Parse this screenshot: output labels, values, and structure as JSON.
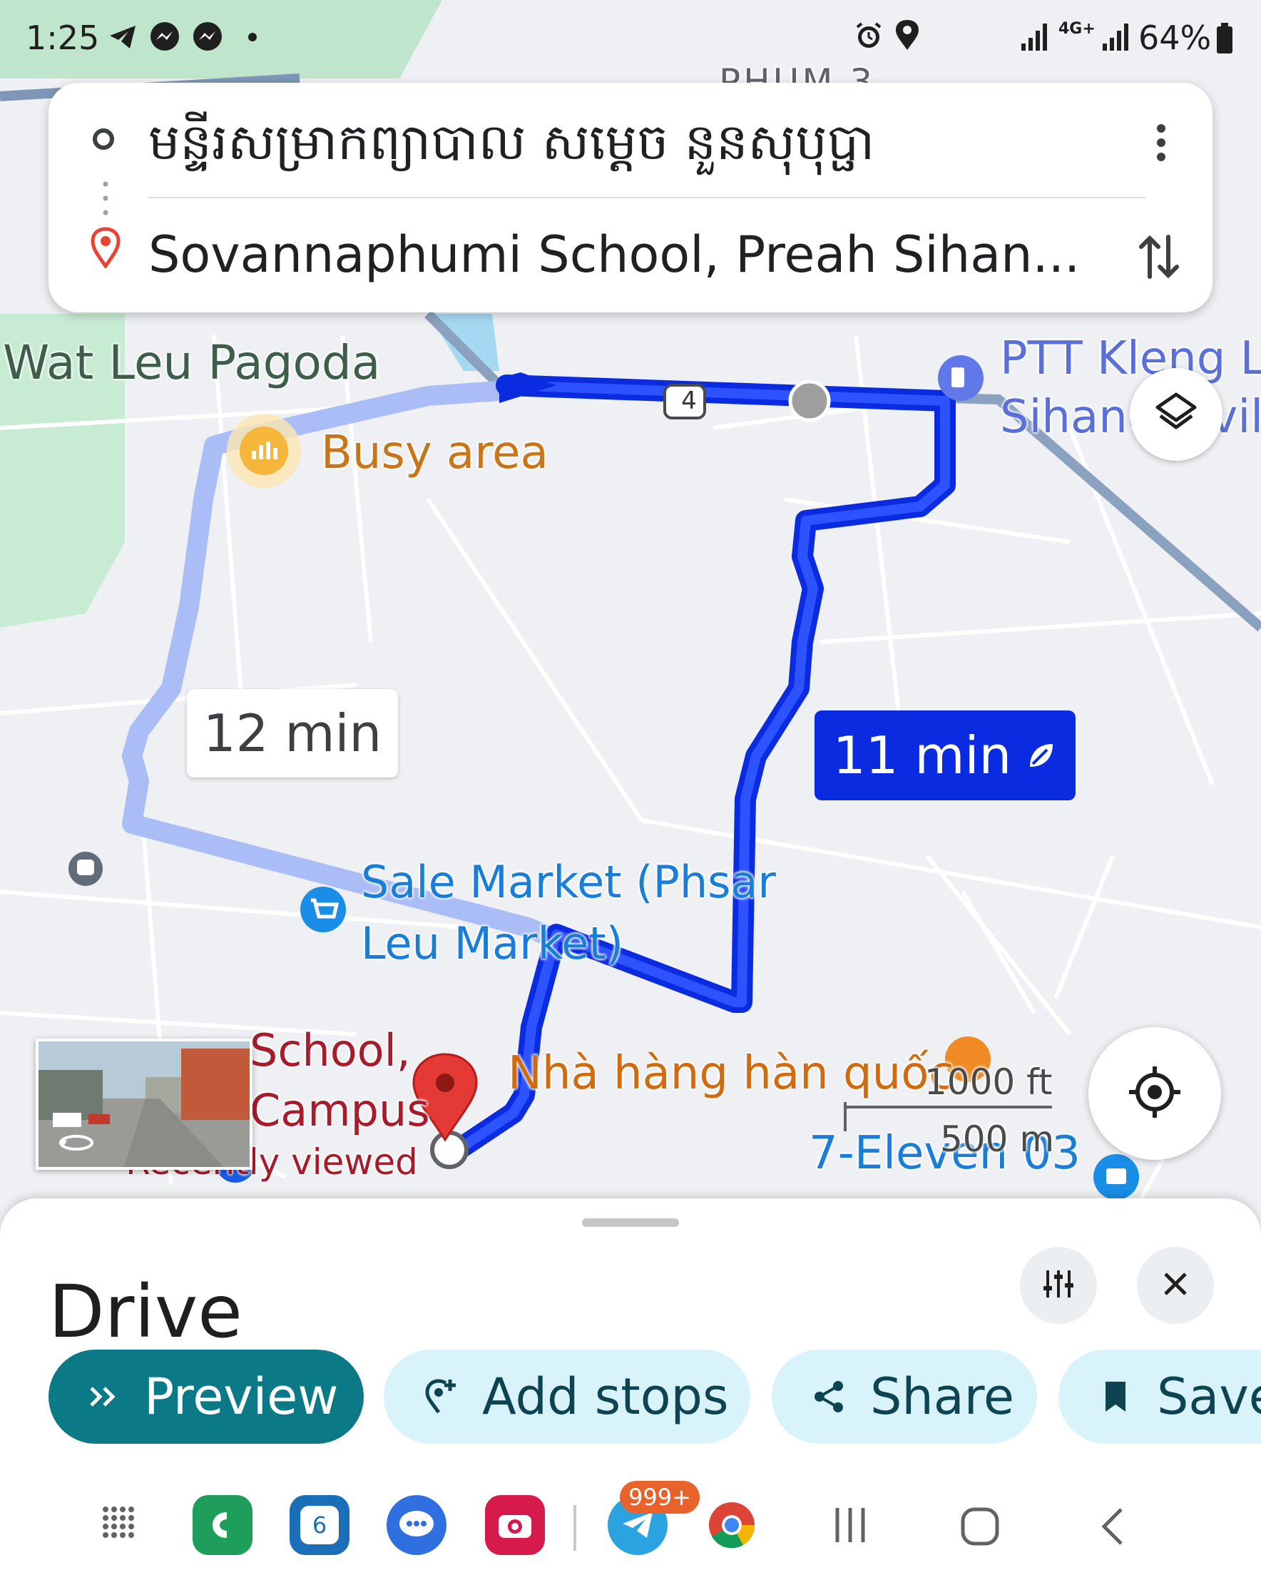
{
  "status_bar": {
    "time": "1:25",
    "network": "4G+",
    "battery": "64%",
    "left_icons": [
      "telegram-icon",
      "messenger-icon",
      "messenger-icon",
      "dot-icon"
    ],
    "right_icons": [
      "alarm-icon",
      "location-icon",
      "signal-icon",
      "signal-icon",
      "battery-icon"
    ]
  },
  "directions": {
    "origin": "មន្ទីរសម្រាកព្យាបាល សម្តេច នួនសុបុប្ផា",
    "destination": "Sovannaphumi School, Preah Sihan..."
  },
  "map": {
    "labels": {
      "top_partial": "PHUM 3",
      "wat_leu": "Wat Leu Pagoda",
      "ptt_line1": "PTT Kleng Lu",
      "ptt_line2": "Sihanoukville",
      "busy_area": "Busy area",
      "sale_market_line1": "Sale Market (Phsar",
      "sale_market_line2": "Leu Market)",
      "school_line1": "School,",
      "school_line2": "Campus",
      "recently_viewed": "Recently viewed",
      "restaurant": "Nhà hàng hàn quốc",
      "seven_eleven": "7-Eleven 03",
      "road_shield": "4"
    },
    "route_times": {
      "alt": "12 min",
      "primary": "11 min"
    },
    "scale": {
      "imperial": "1000 ft",
      "metric": "500 m"
    },
    "colors": {
      "route_primary": "#0b2be0",
      "route_alt": "#aabdf7",
      "destination_pin": "#e53935",
      "map_bg": "#eef0f3"
    }
  },
  "sheet": {
    "title": "Drive",
    "chips": {
      "preview": "Preview",
      "add_stops": "Add stops",
      "share": "Share",
      "save": "Save"
    }
  },
  "taskbar": {
    "apps": [
      "apps-grid-icon",
      "phone-app-icon",
      "calendar-app-icon",
      "messages-app-icon",
      "camera-app-icon",
      "telegram-app-icon",
      "chrome-app-icon"
    ],
    "calendar_day": "6",
    "telegram_badge": "999+",
    "nav": [
      "recents-icon",
      "home-icon",
      "back-icon"
    ]
  }
}
